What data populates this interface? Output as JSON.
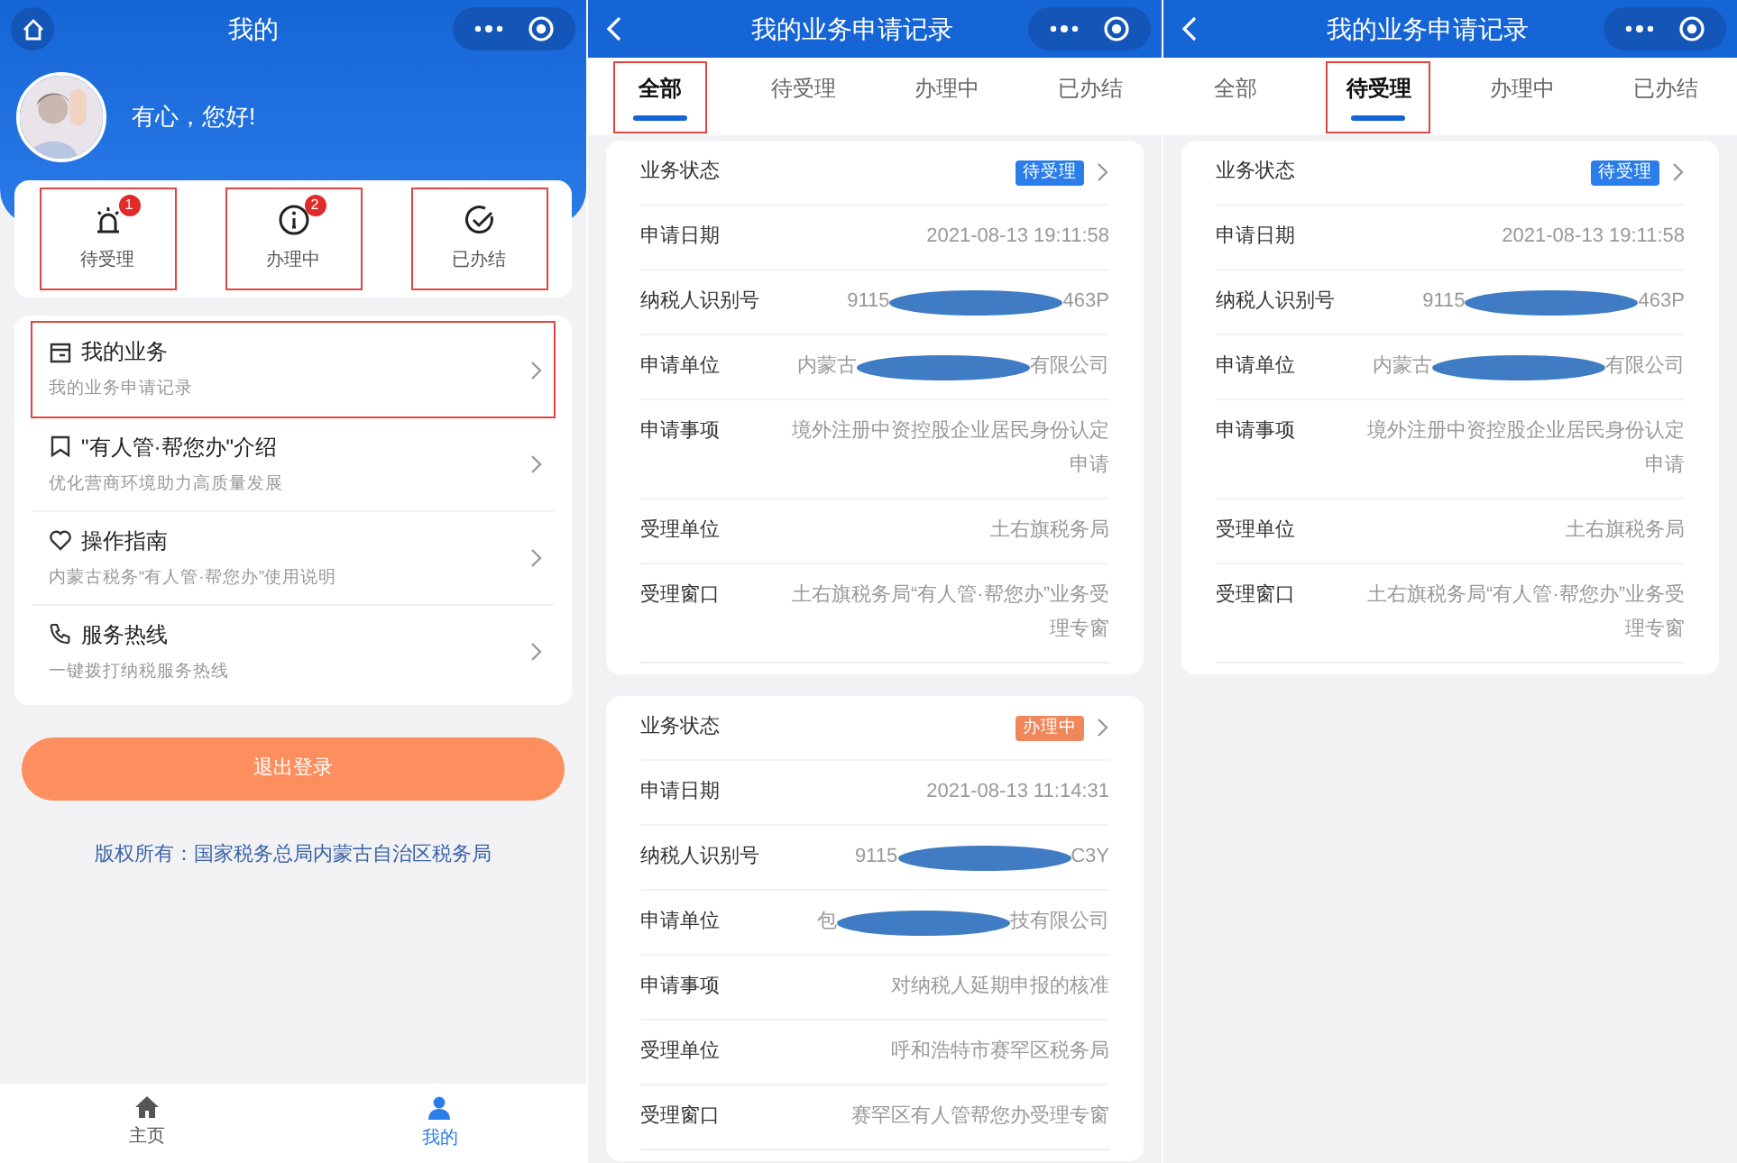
{
  "profile_screen": {
    "title": "我的",
    "greeting": "有心，您好!",
    "stats": [
      {
        "label": "待受理",
        "badge": "1",
        "highlighted": true
      },
      {
        "label": "办理中",
        "badge": "2",
        "highlighted": true
      },
      {
        "label": "已办结",
        "highlighted": true
      }
    ],
    "menu": [
      {
        "title": "我的业务",
        "subtitle": "我的业务申请记录",
        "highlighted": true
      },
      {
        "title": "\"有人管·帮您办\"介绍",
        "subtitle": "优化营商环境助力高质量发展",
        "highlighted": false
      },
      {
        "title": "操作指南",
        "subtitle": "内蒙古税务“有人管·帮您办”使用说明",
        "highlighted": false
      },
      {
        "title": "服务热线",
        "subtitle": "一键拨打纳税服务热线",
        "highlighted": false
      }
    ],
    "logout_button": "退出登录",
    "copyright": "版权所有：国家税务总局内蒙古自治区税务局",
    "bottom_nav": [
      {
        "label": "主页",
        "selected": false
      },
      {
        "label": "我的",
        "selected": true
      }
    ]
  },
  "records_screens": [
    {
      "title": "我的业务申请记录",
      "tabs": [
        {
          "label": "全部",
          "selected": true,
          "highlighted": true
        },
        {
          "label": "待受理",
          "selected": false,
          "highlighted": false
        },
        {
          "label": "办理中",
          "selected": false,
          "highlighted": false
        },
        {
          "label": "已办结",
          "selected": false,
          "highlighted": false
        }
      ],
      "cards": [
        {
          "rows": [
            {
              "kind": "status",
              "label": "业务状态",
              "tag": "待受理",
              "color": "#2b7de9"
            },
            {
              "kind": "text",
              "label": "申请日期",
              "value": "2021-08-13 19:11:58"
            },
            {
              "kind": "redacted",
              "label": "纳税人识别号",
              "value_start": "9115",
              "value_end": "463P"
            },
            {
              "kind": "redacted",
              "label": "申请单位",
              "value_start": "内蒙古",
              "value_end": "有限公司"
            },
            {
              "kind": "text",
              "label": "申请事项",
              "value": "境外注册中资控股企业居民身份认定申请"
            },
            {
              "kind": "text",
              "label": "受理单位",
              "value": "土右旗税务局"
            },
            {
              "kind": "text",
              "label": "受理窗口",
              "value": "土右旗税务局“有人管·帮您办”业务受理专窗"
            }
          ]
        },
        {
          "rows": [
            {
              "kind": "status",
              "label": "业务状态",
              "tag": "办理中",
              "color": "#f0875a"
            },
            {
              "kind": "text",
              "label": "申请日期",
              "value": "2021-08-13 11:14:31"
            },
            {
              "kind": "redacted",
              "label": "纳税人识别号",
              "value_start": "9115",
              "value_end": "C3Y"
            },
            {
              "kind": "redacted",
              "label": "申请单位",
              "value_start": "包",
              "value_end": "技有限公司"
            },
            {
              "kind": "text",
              "label": "申请事项",
              "value": "对纳税人延期申报的核准"
            },
            {
              "kind": "text",
              "label": "受理单位",
              "value": "呼和浩特市赛罕区税务局"
            },
            {
              "kind": "text",
              "label": "受理窗口",
              "value": "赛罕区有人管帮您办受理专窗"
            }
          ]
        }
      ]
    },
    {
      "title": "我的业务申请记录",
      "tabs": [
        {
          "label": "全部",
          "selected": false,
          "highlighted": false
        },
        {
          "label": "待受理",
          "selected": true,
          "highlighted": true
        },
        {
          "label": "办理中",
          "selected": false,
          "highlighted": false
        },
        {
          "label": "已办结",
          "selected": false,
          "highlighted": false
        }
      ],
      "cards": [
        {
          "rows": [
            {
              "kind": "status",
              "label": "业务状态",
              "tag": "待受理",
              "color": "#2b7de9"
            },
            {
              "kind": "text",
              "label": "申请日期",
              "value": "2021-08-13 19:11:58"
            },
            {
              "kind": "redacted",
              "label": "纳税人识别号",
              "value_start": "9115",
              "value_end": "463P"
            },
            {
              "kind": "redacted",
              "label": "申请单位",
              "value_start": "内蒙古",
              "value_end": "有限公司"
            },
            {
              "kind": "text",
              "label": "申请事项",
              "value": "境外注册中资控股企业居民身份认定申请"
            },
            {
              "kind": "text",
              "label": "受理单位",
              "value": "土右旗税务局"
            },
            {
              "kind": "text",
              "label": "受理窗口",
              "value": "土右旗税务局“有人管·帮您办”业务受理专窗"
            }
          ]
        }
      ]
    }
  ]
}
